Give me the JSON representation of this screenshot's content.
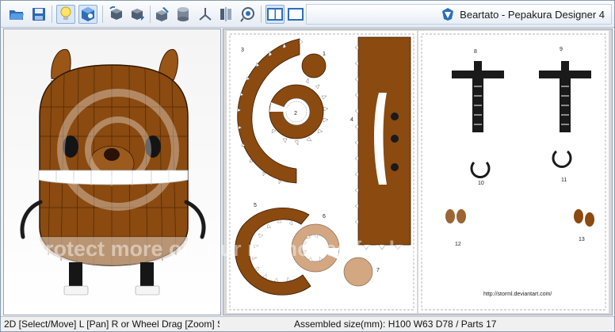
{
  "window": {
    "title": "Beartato - Pepakura Designer 4"
  },
  "toolbar": {
    "buttons": [
      {
        "icon": "open-folder-icon"
      },
      {
        "icon": "save-disk-icon"
      },
      {
        "icon": "lightbulb-icon"
      },
      {
        "icon": "texture-cube-icon"
      },
      {
        "icon": "rotate-cube-icon"
      },
      {
        "icon": "move-cube-icon"
      },
      {
        "icon": "cube-edit-icon"
      },
      {
        "icon": "cylinder-icon"
      },
      {
        "icon": "axes-icon"
      },
      {
        "icon": "mirror-icon"
      },
      {
        "icon": "view-eye-icon"
      },
      {
        "icon": "split-view-icon"
      },
      {
        "icon": "single-view-icon"
      }
    ]
  },
  "sheet": {
    "part_labels": [
      "1",
      "2",
      "3",
      "4",
      "5",
      "6",
      "7",
      "8",
      "9",
      "10",
      "11",
      "12",
      "13"
    ],
    "credit": "http://storml.deviantart.com/"
  },
  "watermark": {
    "text": "Protect more of your memories for less!"
  },
  "status": {
    "left": "2D [Select/Move] L [Pan] R or Wheel Drag [Zoom] S",
    "right": "Assembled size(mm): H100 W63 D78 / Parts 17"
  },
  "colors": {
    "brown": "#8a4a10",
    "tan": "#d2a781",
    "toolbar_accent": "#2d6fb8"
  }
}
